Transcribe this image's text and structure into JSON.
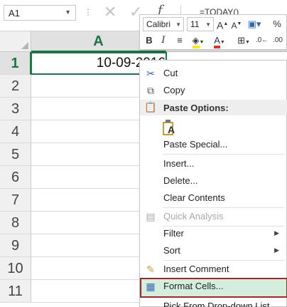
{
  "formula_bar": {
    "name_box": "A1",
    "cancel_symbol": "✕",
    "enter_symbol": "✓",
    "fx_symbol": "f",
    "formula_value": "=TODAY()"
  },
  "sheet": {
    "column_header": "A",
    "row_headers": [
      "1",
      "2",
      "3",
      "4",
      "5",
      "6",
      "7",
      "8",
      "9",
      "10",
      "11"
    ],
    "cell_a1_value": "10-09-2016"
  },
  "mini_toolbar": {
    "font_name": "Calibri",
    "font_size": "11",
    "grow_font": "A",
    "shrink_font": "A",
    "number_format": "%",
    "bold": "B",
    "italic": "I",
    "font_color_letter": "A",
    "font_color": "#e0302a",
    "fill_color": "#ffe800"
  },
  "context_menu": {
    "cut": "Cut",
    "copy": "Copy",
    "paste_options": "Paste Options:",
    "paste_option_letter": "A",
    "paste_special": "Paste Special...",
    "insert": "Insert...",
    "delete": "Delete...",
    "clear_contents": "Clear Contents",
    "quick_analysis": "Quick Analysis",
    "filter": "Filter",
    "sort": "Sort",
    "insert_comment": "Insert Comment",
    "format_cells": "Format Cells...",
    "pick_from_dropdown": "Pick From Drop-down List..."
  },
  "colors": {
    "excel_green": "#217346",
    "highlight_fill": "#d4eddc",
    "highlight_border": "#9c2a2a"
  }
}
